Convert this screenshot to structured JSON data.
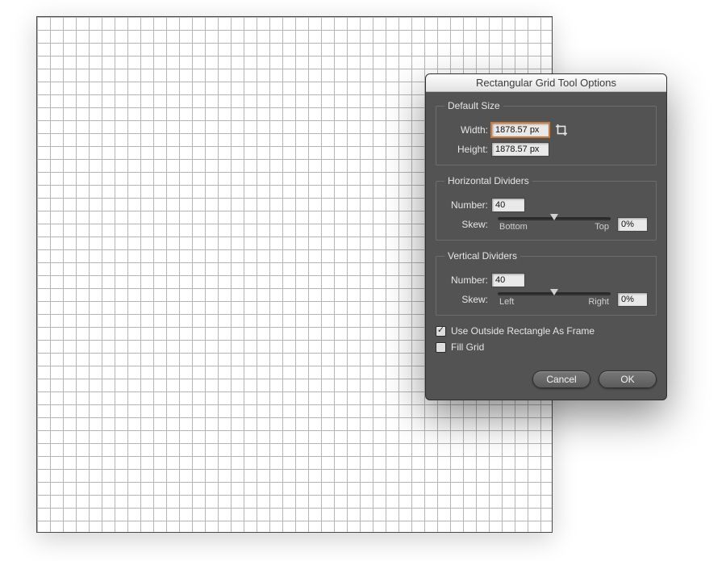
{
  "dialog_title": "Rectangular Grid Tool Options",
  "default_size": {
    "legend": "Default Size",
    "width_label": "Width:",
    "width_value": "1878.57 px",
    "height_label": "Height:",
    "height_value": "1878.57 px"
  },
  "horizontal": {
    "legend": "Horizontal Dividers",
    "number_label": "Number:",
    "number_value": "40",
    "skew_label": "Skew:",
    "skew_value": "0%",
    "left_label": "Bottom",
    "right_label": "Top"
  },
  "vertical": {
    "legend": "Vertical Dividers",
    "number_label": "Number:",
    "number_value": "40",
    "skew_label": "Skew:",
    "skew_value": "0%",
    "left_label": "Left",
    "right_label": "Right"
  },
  "use_frame_label": "Use Outside Rectangle As Frame",
  "use_frame_checked": true,
  "fill_grid_label": "Fill Grid",
  "fill_grid_checked": false,
  "cancel_label": "Cancel",
  "ok_label": "OK"
}
